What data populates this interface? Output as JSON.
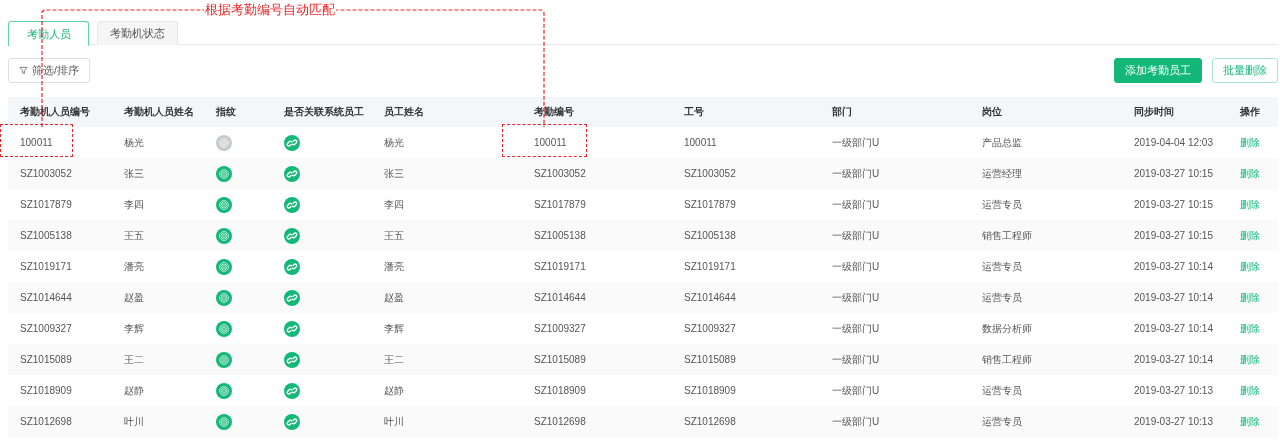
{
  "tabs": [
    {
      "label": "考勤人员",
      "selected": true
    },
    {
      "label": "考勤机状态",
      "selected": false
    }
  ],
  "toolbar": {
    "filter_button": "筛选/排序",
    "buttons": [
      {
        "label": "添加考勤员工",
        "kind": "primary"
      },
      {
        "label": "批量删除",
        "kind": "outline"
      }
    ]
  },
  "table": {
    "columns": [
      "考勤机人员编号",
      "考勤机人员姓名",
      "指纹",
      "是否关联系统员工",
      "员工姓名",
      "考勤编号",
      "工号",
      "部门",
      "岗位",
      "同步时间",
      "操作"
    ],
    "rows": [
      {
        "device_id": "100011",
        "device_name": "杨光",
        "fingerprint": false,
        "linked": true,
        "employee_name": "杨光",
        "attendance_no": "100011",
        "employee_no": "100011",
        "department": "一级部门U",
        "position": "产品总监",
        "sync_time": "2019-04-04 12:03",
        "action": "删除"
      },
      {
        "device_id": "SZ1003052",
        "device_name": "张三",
        "fingerprint": true,
        "linked": true,
        "employee_name": "张三",
        "attendance_no": "SZ1003052",
        "employee_no": "SZ1003052",
        "department": "一级部门U",
        "position": "运营经理",
        "sync_time": "2019-03-27 10:15",
        "action": "删除"
      },
      {
        "device_id": "SZ1017879",
        "device_name": "李四",
        "fingerprint": true,
        "linked": true,
        "employee_name": "李四",
        "attendance_no": "SZ1017879",
        "employee_no": "SZ1017879",
        "department": "一级部门U",
        "position": "运营专员",
        "sync_time": "2019-03-27 10:15",
        "action": "删除"
      },
      {
        "device_id": "SZ1005138",
        "device_name": "王五",
        "fingerprint": true,
        "linked": true,
        "employee_name": "王五",
        "attendance_no": "SZ1005138",
        "employee_no": "SZ1005138",
        "department": "一级部门U",
        "position": "销售工程师",
        "sync_time": "2019-03-27 10:15",
        "action": "删除"
      },
      {
        "device_id": "SZ1019171",
        "device_name": "潘亮",
        "fingerprint": true,
        "linked": true,
        "employee_name": "潘亮",
        "attendance_no": "SZ1019171",
        "employee_no": "SZ1019171",
        "department": "一级部门U",
        "position": "运营专员",
        "sync_time": "2019-03-27 10:14",
        "action": "删除"
      },
      {
        "device_id": "SZ1014644",
        "device_name": "赵盈",
        "fingerprint": true,
        "linked": true,
        "employee_name": "赵盈",
        "attendance_no": "SZ1014644",
        "employee_no": "SZ1014644",
        "department": "一级部门U",
        "position": "运营专员",
        "sync_time": "2019-03-27 10:14",
        "action": "删除"
      },
      {
        "device_id": "SZ1009327",
        "device_name": "李辉",
        "fingerprint": true,
        "linked": true,
        "employee_name": "李辉",
        "attendance_no": "SZ1009327",
        "employee_no": "SZ1009327",
        "department": "一级部门U",
        "position": "数据分析师",
        "sync_time": "2019-03-27 10:14",
        "action": "删除"
      },
      {
        "device_id": "SZ1015089",
        "device_name": "王二",
        "fingerprint": true,
        "linked": true,
        "employee_name": "王二",
        "attendance_no": "SZ1015089",
        "employee_no": "SZ1015089",
        "department": "一级部门U",
        "position": "销售工程师",
        "sync_time": "2019-03-27 10:14",
        "action": "删除"
      },
      {
        "device_id": "SZ1018909",
        "device_name": "赵静",
        "fingerprint": true,
        "linked": true,
        "employee_name": "赵静",
        "attendance_no": "SZ1018909",
        "employee_no": "SZ1018909",
        "department": "一级部门U",
        "position": "运营专员",
        "sync_time": "2019-03-27 10:13",
        "action": "删除"
      },
      {
        "device_id": "SZ1012698",
        "device_name": "叶川",
        "fingerprint": true,
        "linked": true,
        "employee_name": "叶川",
        "attendance_no": "SZ1012698",
        "employee_no": "SZ1012698",
        "department": "一级部门U",
        "position": "运营专员",
        "sync_time": "2019-03-27 10:13",
        "action": "删除"
      }
    ]
  },
  "annotation": {
    "text": "根据考勤编号自动匹配"
  }
}
